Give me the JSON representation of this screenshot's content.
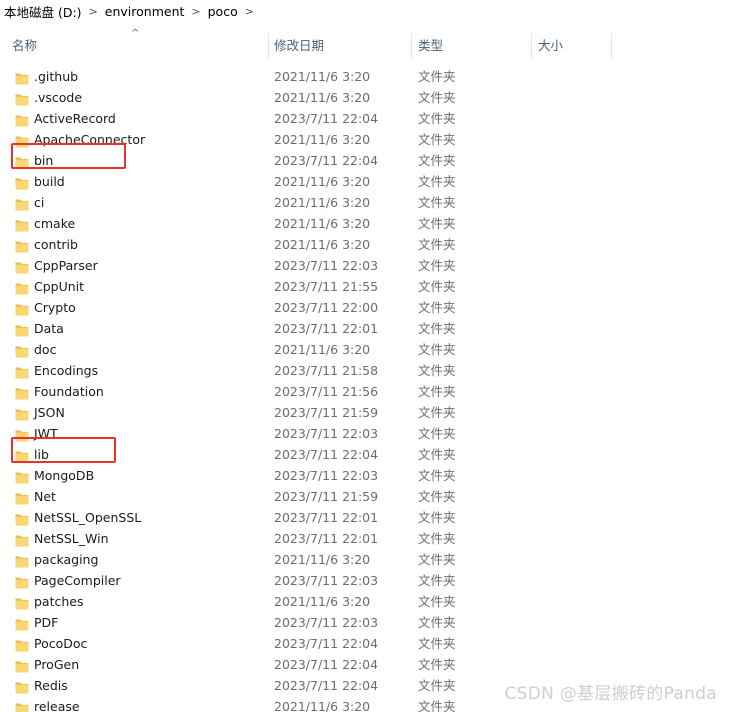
{
  "breadcrumb": {
    "items": [
      "本地磁盘 (D:)",
      "environment",
      "poco"
    ],
    "separator": ">"
  },
  "columns": {
    "name": "名称",
    "date": "修改日期",
    "type": "类型",
    "size": "大小"
  },
  "sort_indicator": "^",
  "folder_icon": "folder-icon",
  "colors": {
    "folder_yellow": "#f8d775",
    "folder_dark": "#e8b84a",
    "highlight_red": "#e8322b",
    "header_text": "#4c607a"
  },
  "files": [
    {
      "name": ".github",
      "date": "2021/11/6 3:20",
      "type": "文件夹"
    },
    {
      "name": ".vscode",
      "date": "2021/11/6 3:20",
      "type": "文件夹"
    },
    {
      "name": "ActiveRecord",
      "date": "2023/7/11 22:04",
      "type": "文件夹"
    },
    {
      "name": "ApacheConnector",
      "date": "2021/11/6 3:20",
      "type": "文件夹"
    },
    {
      "name": "bin",
      "date": "2023/7/11 22:04",
      "type": "文件夹",
      "highlighted": true
    },
    {
      "name": "build",
      "date": "2021/11/6 3:20",
      "type": "文件夹"
    },
    {
      "name": "ci",
      "date": "2021/11/6 3:20",
      "type": "文件夹"
    },
    {
      "name": "cmake",
      "date": "2021/11/6 3:20",
      "type": "文件夹"
    },
    {
      "name": "contrib",
      "date": "2021/11/6 3:20",
      "type": "文件夹"
    },
    {
      "name": "CppParser",
      "date": "2023/7/11 22:03",
      "type": "文件夹"
    },
    {
      "name": "CppUnit",
      "date": "2023/7/11 21:55",
      "type": "文件夹"
    },
    {
      "name": "Crypto",
      "date": "2023/7/11 22:00",
      "type": "文件夹"
    },
    {
      "name": "Data",
      "date": "2023/7/11 22:01",
      "type": "文件夹"
    },
    {
      "name": "doc",
      "date": "2021/11/6 3:20",
      "type": "文件夹"
    },
    {
      "name": "Encodings",
      "date": "2023/7/11 21:58",
      "type": "文件夹"
    },
    {
      "name": "Foundation",
      "date": "2023/7/11 21:56",
      "type": "文件夹"
    },
    {
      "name": "JSON",
      "date": "2023/7/11 21:59",
      "type": "文件夹"
    },
    {
      "name": "JWT",
      "date": "2023/7/11 22:03",
      "type": "文件夹"
    },
    {
      "name": "lib",
      "date": "2023/7/11 22:04",
      "type": "文件夹",
      "highlighted": true
    },
    {
      "name": "MongoDB",
      "date": "2023/7/11 22:03",
      "type": "文件夹"
    },
    {
      "name": "Net",
      "date": "2023/7/11 21:59",
      "type": "文件夹"
    },
    {
      "name": "NetSSL_OpenSSL",
      "date": "2023/7/11 22:01",
      "type": "文件夹"
    },
    {
      "name": "NetSSL_Win",
      "date": "2023/7/11 22:01",
      "type": "文件夹"
    },
    {
      "name": "packaging",
      "date": "2021/11/6 3:20",
      "type": "文件夹"
    },
    {
      "name": "PageCompiler",
      "date": "2023/7/11 22:03",
      "type": "文件夹"
    },
    {
      "name": "patches",
      "date": "2021/11/6 3:20",
      "type": "文件夹"
    },
    {
      "name": "PDF",
      "date": "2023/7/11 22:03",
      "type": "文件夹"
    },
    {
      "name": "PocoDoc",
      "date": "2023/7/11 22:04",
      "type": "文件夹"
    },
    {
      "name": "ProGen",
      "date": "2023/7/11 22:04",
      "type": "文件夹"
    },
    {
      "name": "Redis",
      "date": "2023/7/11 22:04",
      "type": "文件夹"
    },
    {
      "name": "release",
      "date": "2021/11/6 3:20",
      "type": "文件夹"
    }
  ],
  "watermark": "CSDN @基层搬砖的Panda"
}
